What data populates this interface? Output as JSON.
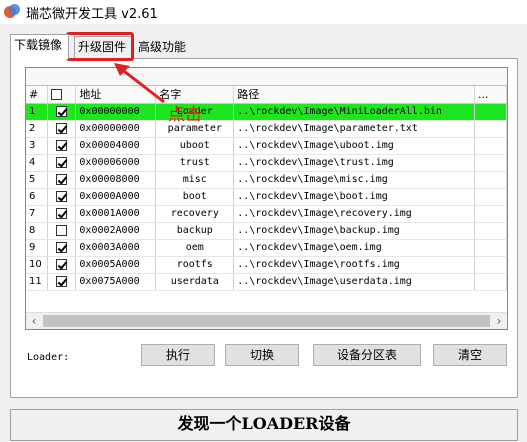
{
  "window": {
    "title": "瑞芯微开发工具 v2.61"
  },
  "tabs": [
    {
      "label": "下载镜像"
    },
    {
      "label": "升级固件"
    },
    {
      "label": "高级功能"
    }
  ],
  "table": {
    "columns": [
      "#",
      "",
      "地址",
      "名字",
      "路径",
      "..."
    ],
    "rows": [
      {
        "idx": "1",
        "checked": true,
        "address": "0x00000000",
        "name": "Loader",
        "path": "..\\rockdev\\Image\\MiniLoaderAll.bin",
        "selected": true
      },
      {
        "idx": "2",
        "checked": true,
        "address": "0x00000000",
        "name": "parameter",
        "path": "..\\rockdev\\Image\\parameter.txt",
        "selected": false
      },
      {
        "idx": "3",
        "checked": true,
        "address": "0x00004000",
        "name": "uboot",
        "path": "..\\rockdev\\Image\\uboot.img",
        "selected": false
      },
      {
        "idx": "4",
        "checked": true,
        "address": "0x00006000",
        "name": "trust",
        "path": "..\\rockdev\\Image\\trust.img",
        "selected": false
      },
      {
        "idx": "5",
        "checked": true,
        "address": "0x00008000",
        "name": "misc",
        "path": "..\\rockdev\\Image\\misc.img",
        "selected": false
      },
      {
        "idx": "6",
        "checked": true,
        "address": "0x0000A000",
        "name": "boot",
        "path": "..\\rockdev\\Image\\boot.img",
        "selected": false
      },
      {
        "idx": "7",
        "checked": true,
        "address": "0x0001A000",
        "name": "recovery",
        "path": "..\\rockdev\\Image\\recovery.img",
        "selected": false
      },
      {
        "idx": "8",
        "checked": false,
        "address": "0x0002A000",
        "name": "backup",
        "path": "..\\rockdev\\Image\\backup.img",
        "selected": false
      },
      {
        "idx": "9",
        "checked": true,
        "address": "0x0003A000",
        "name": "oem",
        "path": "..\\rockdev\\Image\\oem.img",
        "selected": false
      },
      {
        "idx": "10",
        "checked": true,
        "address": "0x0005A000",
        "name": "rootfs",
        "path": "..\\rockdev\\Image\\rootfs.img",
        "selected": false
      },
      {
        "idx": "11",
        "checked": true,
        "address": "0x0075A000",
        "name": "userdata",
        "path": "..\\rockdev\\Image\\userdata.img",
        "selected": false
      }
    ]
  },
  "loader_label": "Loader:",
  "buttons": {
    "run": "执行",
    "switch": "切换",
    "partition": "设备分区表",
    "clear": "清空"
  },
  "status": "发现一个LOADER设备",
  "annotation": {
    "text": "点击"
  },
  "colors": {
    "selected_row": "#1ee61e",
    "annotation": "#e02020"
  }
}
